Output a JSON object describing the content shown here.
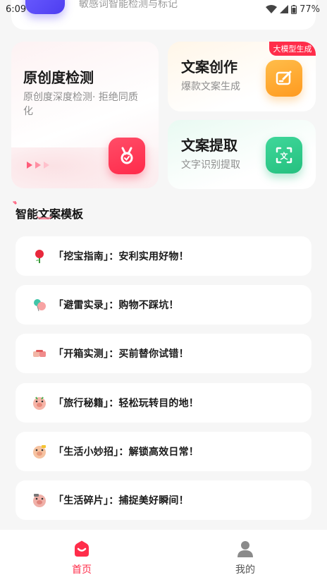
{
  "status_bar": {
    "time": "6:09",
    "battery": "77%"
  },
  "top_card": {
    "text": "敏感词智能检测与标记"
  },
  "features": {
    "original": {
      "title": "原创度检测",
      "subtitle": "原创度深度检测· 拒绝同质化"
    },
    "copywriting": {
      "title": "文案创作",
      "subtitle": "爆款文案生成",
      "badge": "大模型生成"
    },
    "extract": {
      "title": "文案提取",
      "subtitle": "文字识别提取"
    }
  },
  "section": {
    "title": "智能文案模板"
  },
  "templates": [
    {
      "icon": "rose-icon",
      "text": "「挖宝指南」：安利实用好物！"
    },
    {
      "icon": "balloon-icon",
      "text": "「避雷实录」：购物不踩坑！"
    },
    {
      "icon": "thumbs-down-icon",
      "text": "「开箱实测」：买前替你试错！"
    },
    {
      "icon": "pig-face-icon",
      "text": "「旅行秘籍」：轻松玩转目的地！"
    },
    {
      "icon": "pig-face-icon",
      "text": "「生活小妙招」：解锁高效日常！"
    },
    {
      "icon": "pig-face-icon",
      "text": "「生活碎片」：捕捉美好瞬间！"
    }
  ],
  "bottom_nav": {
    "home": "首页",
    "mine": "我的"
  },
  "colors": {
    "accent": "#ff2d4a",
    "orange": "#ff9a1f",
    "green": "#25c07f"
  }
}
